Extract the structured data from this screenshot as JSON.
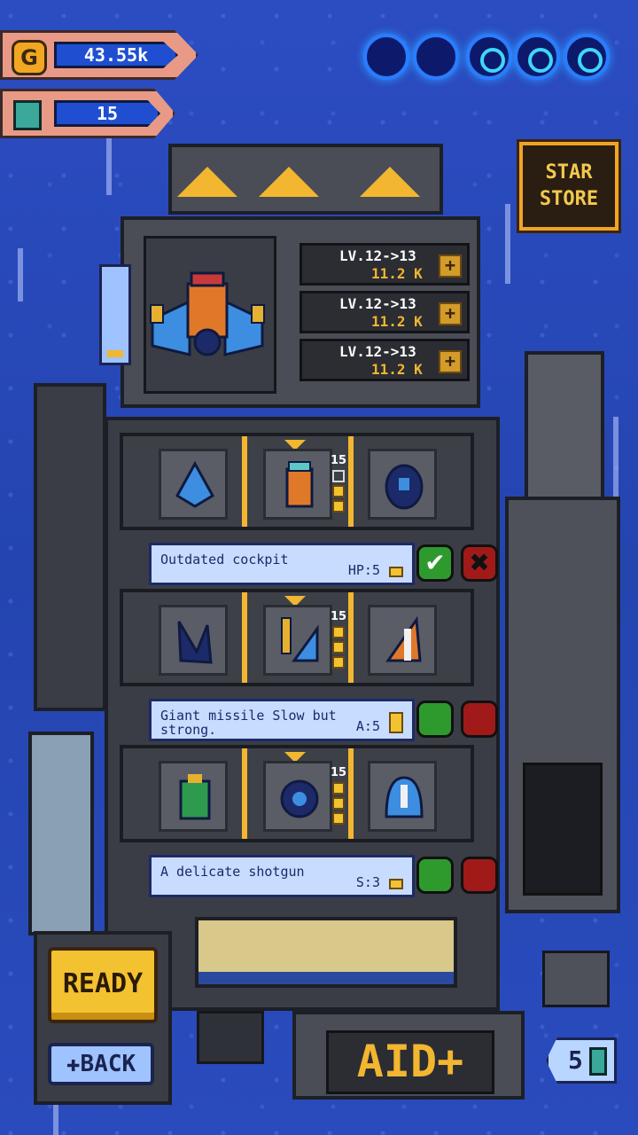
{
  "hud": {
    "gold_icon": "G",
    "gold_value": "43.55k",
    "energy_icon": "energy-cell-icon",
    "energy_value": "15"
  },
  "orbs": [
    {
      "state": "empty"
    },
    {
      "state": "empty"
    },
    {
      "state": "lit"
    },
    {
      "state": "lit"
    },
    {
      "state": "lit"
    }
  ],
  "star_store": {
    "line1": "STAR",
    "line2": "STORE"
  },
  "upgrades": [
    {
      "level": "LV.12->13",
      "cost": "11.2 K",
      "plus": "+"
    },
    {
      "level": "LV.12->13",
      "cost": "11.2 K",
      "plus": "+"
    },
    {
      "level": "LV.12->13",
      "cost": "11.2 K",
      "plus": "+"
    }
  ],
  "rows": [
    {
      "count": "15",
      "description": "Outdated cockpit",
      "stat": "HP:5",
      "confirm": "✔",
      "cancel": "✖"
    },
    {
      "count": "15",
      "description": "Giant missile Slow but strong.",
      "stat": "A:5"
    },
    {
      "count": "15",
      "description": "A delicate shotgun",
      "stat": "S:3"
    }
  ],
  "buttons": {
    "ready": "READY",
    "back": "✚BACK",
    "aid": "AID+"
  },
  "aid_count": "5",
  "colors": {
    "accent": "#f2b630",
    "background": "#2947b8",
    "panel": "#4a4d56",
    "confirm": "#2e9a2e",
    "cancel": "#a11a1a"
  }
}
